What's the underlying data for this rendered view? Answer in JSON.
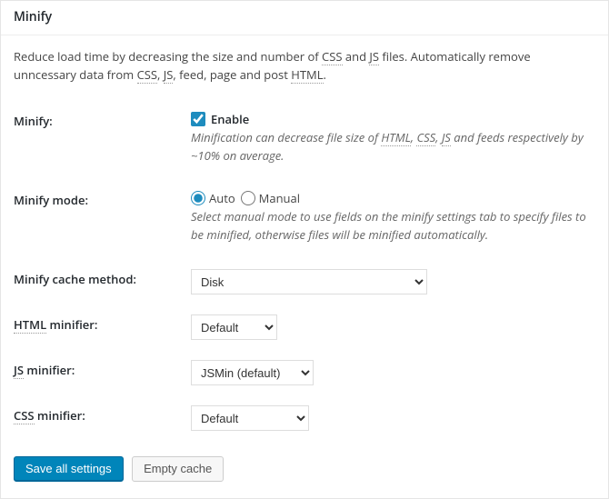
{
  "header": {
    "title": "Minify"
  },
  "intro": {
    "pre": "Reduce load time by decreasing the size and number of ",
    "css": "CSS",
    "mid1": " and ",
    "js": "JS",
    "mid2": " files. Automatically remove unncessary data from ",
    "css2": "CSS",
    "sep1": ", ",
    "js2": "JS",
    "mid3": ", feed, page and post ",
    "html": "HTML",
    "end": "."
  },
  "rows": {
    "minify": {
      "label": "Minify:",
      "enable": "Enable",
      "desc_pre": "Minification can decrease file size of ",
      "d_html": "HTML",
      "d_s1": ", ",
      "d_css": "CSS",
      "d_s2": ", ",
      "d_js": "JS",
      "desc_post": " and feeds respectively by ~10% on average."
    },
    "mode": {
      "label": "Minify mode:",
      "auto": "Auto",
      "manual": "Manual",
      "desc": "Select manual mode to use fields on the minify settings tab to specify files to be minified, otherwise files will be minified automatically."
    },
    "cache": {
      "label": "Minify cache method:",
      "value": "Disk"
    },
    "html_min": {
      "label_pre": "HTML",
      "label_post": " minifier:",
      "value": "Default"
    },
    "js_min": {
      "label_pre": "JS",
      "label_post": " minifier:",
      "value": "JSMin (default)"
    },
    "css_min": {
      "label_pre": "CSS",
      "label_post": " minifier:",
      "value": "Default"
    }
  },
  "actions": {
    "save": "Save all settings",
    "empty": "Empty cache"
  }
}
